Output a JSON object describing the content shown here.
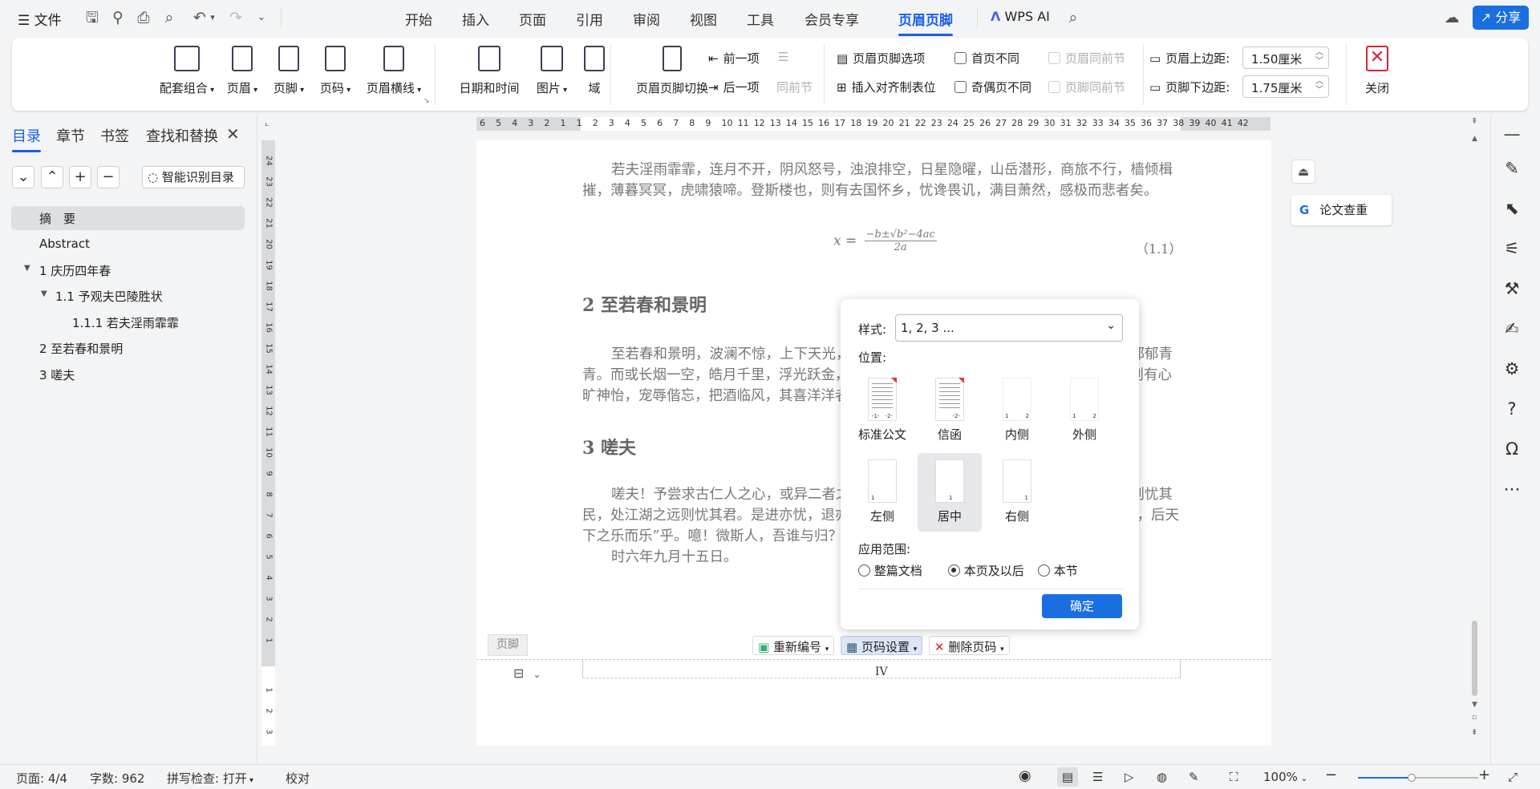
{
  "menubar": {
    "file": "文件",
    "tabs": [
      "开始",
      "插入",
      "页面",
      "引用",
      "审阅",
      "视图",
      "工具",
      "会员专享",
      "页眉页脚"
    ],
    "wps_ai": "WPS AI",
    "share": "分享"
  },
  "ribbon": {
    "big_buttons": [
      "配套组合",
      "页眉",
      "页脚",
      "页码",
      "页眉横线",
      "日期和时间",
      "图片",
      "域",
      "页眉页脚切换",
      "关闭"
    ],
    "prev_item": "前一项",
    "next_item": "后一项",
    "same_section": "同前节",
    "hf_options": "页眉页脚选项",
    "insert_tab": "插入对齐制表位",
    "first_page_diff": "首页不同",
    "odd_even_diff": "奇偶页不同",
    "header_same_prev": "页眉同前节",
    "footer_same_prev": "页脚同前节",
    "header_top_label": "页眉上边距:",
    "header_top_value": "1.50厘米",
    "footer_bottom_label": "页脚下边距:",
    "footer_bottom_value": "1.75厘米"
  },
  "navpane": {
    "tabs": [
      "目录",
      "章节",
      "书签",
      "查找和替换"
    ],
    "smart_toc": "智能识别目录",
    "items": [
      "摘　要",
      "Abstract",
      "1 庆历四年春",
      "1.1 予观夫巴陵胜状",
      "1.1.1 若夫淫雨霏霏",
      "2 至若春和景明",
      "3 嗟夫"
    ]
  },
  "ruler": {
    "h_ticks": [
      "6",
      "5",
      "4",
      "3",
      "2",
      "1",
      "1",
      "2",
      "3",
      "4",
      "5",
      "6",
      "7",
      "8",
      "9",
      "10",
      "11",
      "12",
      "13",
      "14",
      "15",
      "16",
      "17",
      "18",
      "19",
      "20",
      "21",
      "22",
      "23",
      "24",
      "25",
      "26",
      "27",
      "28",
      "29",
      "30",
      "31",
      "32",
      "33",
      "34",
      "35",
      "36",
      "37",
      "38",
      "39",
      "40",
      "41",
      "42"
    ],
    "v_ticks": [
      "24",
      "23",
      "22",
      "21",
      "20",
      "19",
      "18",
      "17",
      "16",
      "15",
      "14",
      "13",
      "12",
      "11",
      "10",
      "9",
      "8",
      "7",
      "6",
      "5",
      "4",
      "3",
      "2",
      "1"
    ],
    "v_ticks_bottom": [
      "1",
      "2",
      "3"
    ]
  },
  "document": {
    "para1": "若夫淫雨霏霏，连月不开，阴风怒号，浊浪排空，日星隐曜，山岳潜形，商旅不行，樯倾楫摧，薄暮冥冥，虎啸猿啼。登斯楼也，则有去国怀乡，忧谗畏讥，满目萧然，感极而悲者矣。",
    "formula_lhs": "x =",
    "formula_num": "−b±√b²−4ac",
    "formula_den": "2a",
    "formula_label": "（1.1）",
    "heading2": "2 至若春和景明",
    "para2": "至若春和景明，波澜不惊，上下天光，一碧万顷，沙鸥翔集，锦鳞游泳，岸芷汀兰，郁郁青青。而或长烟一空，皓月千里，浮光跃金，静影沉璧，渔歌互答，此乐何极！登斯楼也，则有心旷神怡，宠辱偕忘，把酒临风，其喜洋洋者矣。",
    "heading3": "3 嗟夫",
    "para3": "嗟夫！予尝求古仁人之心，或异二者之为，何哉？不以物喜，不以己悲；居庙堂之高则忧其民，处江湖之远则忧其君。是进亦忧，退亦忧。然则何时而乐耶？其必曰“先天下之忧而忧，后天下之乐而乐”乎。噫！微斯人，吾谁与归？",
    "para4": "时六年九月十五日。",
    "footer_tag": "页脚",
    "page_number": "IV"
  },
  "footer_toolbar": {
    "renumber": "重新编号",
    "page_settings": "页码设置",
    "delete": "删除页码"
  },
  "dialog": {
    "style_label": "样式:",
    "style_value": "1, 2, 3 ...",
    "position_label": "位置:",
    "positions": [
      "标准公文",
      "信函",
      "内侧",
      "外侧",
      "左侧",
      "居中",
      "右侧"
    ],
    "selected_position": "居中",
    "scope_label": "应用范围:",
    "scopes": [
      "整篇文档",
      "本页及以后",
      "本节"
    ],
    "selected_scope": "本页及以后",
    "ok": "确定"
  },
  "side": {
    "paper_check": "论文查重"
  },
  "statusbar": {
    "page": "页面: 4/4",
    "words": "字数: 962",
    "spell": "拼写检查: 打开",
    "proof": "校对",
    "zoom": "100%"
  },
  "colors": {
    "accent": "#1a5ee6",
    "primary_button": "#1a6fe0"
  }
}
